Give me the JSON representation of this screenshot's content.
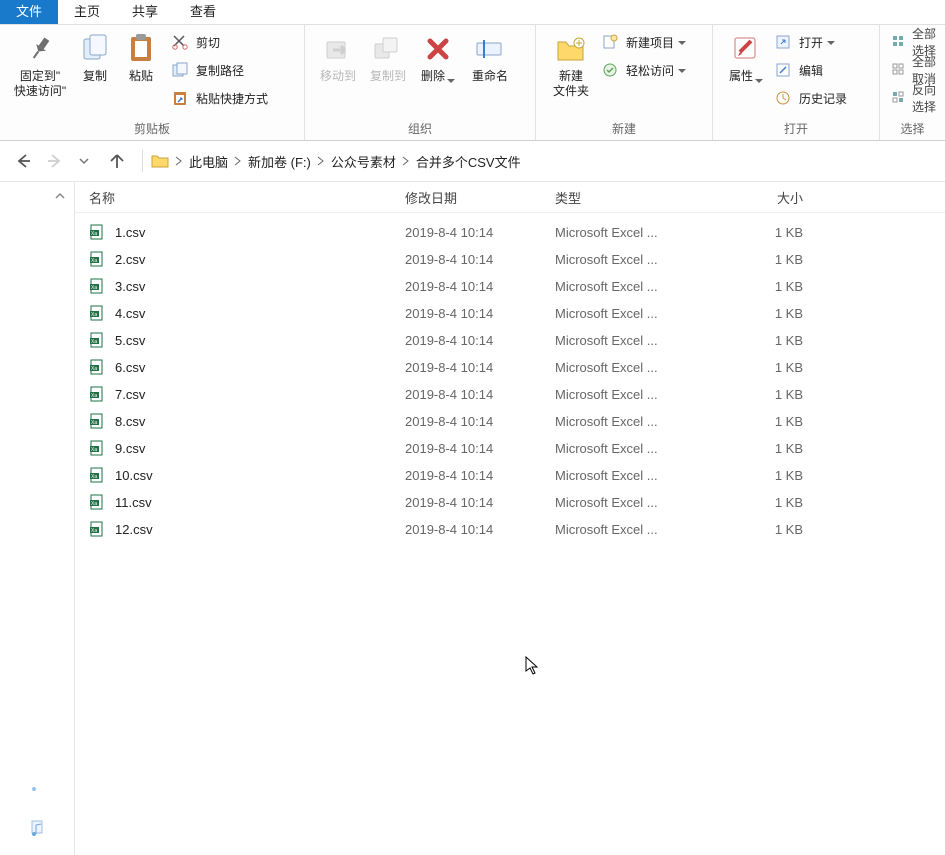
{
  "tabs": {
    "file": "文件",
    "home": "主页",
    "share": "共享",
    "view": "查看"
  },
  "ribbon": {
    "clipboard": {
      "pin": "固定到\"\n快速访问\"",
      "copy": "复制",
      "paste": "粘贴",
      "cut": "剪切",
      "copy_path": "复制路径",
      "paste_shortcut": "粘贴快捷方式",
      "group": "剪贴板"
    },
    "organize": {
      "move_to": "移动到",
      "copy_to": "复制到",
      "delete": "删除",
      "rename": "重命名",
      "group": "组织"
    },
    "new": {
      "new_folder": "新建\n文件夹",
      "new_item": "新建项目",
      "easy_access": "轻松访问",
      "group": "新建"
    },
    "open": {
      "properties": "属性",
      "open": "打开",
      "edit": "编辑",
      "history": "历史记录",
      "group": "打开"
    },
    "select": {
      "select_all": "全部选择",
      "deselect_all": "全部取消",
      "invert": "反向选择",
      "group": "选择"
    }
  },
  "breadcrumbs": [
    "此电脑",
    "新加卷 (F:)",
    "公众号素材",
    "合并多个CSV文件"
  ],
  "columns": {
    "name": "名称",
    "date": "修改日期",
    "type": "类型",
    "size": "大小"
  },
  "files": [
    {
      "name": "1.csv",
      "date": "2019-8-4 10:14",
      "type": "Microsoft Excel ...",
      "size": "1 KB"
    },
    {
      "name": "2.csv",
      "date": "2019-8-4 10:14",
      "type": "Microsoft Excel ...",
      "size": "1 KB"
    },
    {
      "name": "3.csv",
      "date": "2019-8-4 10:14",
      "type": "Microsoft Excel ...",
      "size": "1 KB"
    },
    {
      "name": "4.csv",
      "date": "2019-8-4 10:14",
      "type": "Microsoft Excel ...",
      "size": "1 KB"
    },
    {
      "name": "5.csv",
      "date": "2019-8-4 10:14",
      "type": "Microsoft Excel ...",
      "size": "1 KB"
    },
    {
      "name": "6.csv",
      "date": "2019-8-4 10:14",
      "type": "Microsoft Excel ...",
      "size": "1 KB"
    },
    {
      "name": "7.csv",
      "date": "2019-8-4 10:14",
      "type": "Microsoft Excel ...",
      "size": "1 KB"
    },
    {
      "name": "8.csv",
      "date": "2019-8-4 10:14",
      "type": "Microsoft Excel ...",
      "size": "1 KB"
    },
    {
      "name": "9.csv",
      "date": "2019-8-4 10:14",
      "type": "Microsoft Excel ...",
      "size": "1 KB"
    },
    {
      "name": "10.csv",
      "date": "2019-8-4 10:14",
      "type": "Microsoft Excel ...",
      "size": "1 KB"
    },
    {
      "name": "11.csv",
      "date": "2019-8-4 10:14",
      "type": "Microsoft Excel ...",
      "size": "1 KB"
    },
    {
      "name": "12.csv",
      "date": "2019-8-4 10:14",
      "type": "Microsoft Excel ...",
      "size": "1 KB"
    }
  ]
}
